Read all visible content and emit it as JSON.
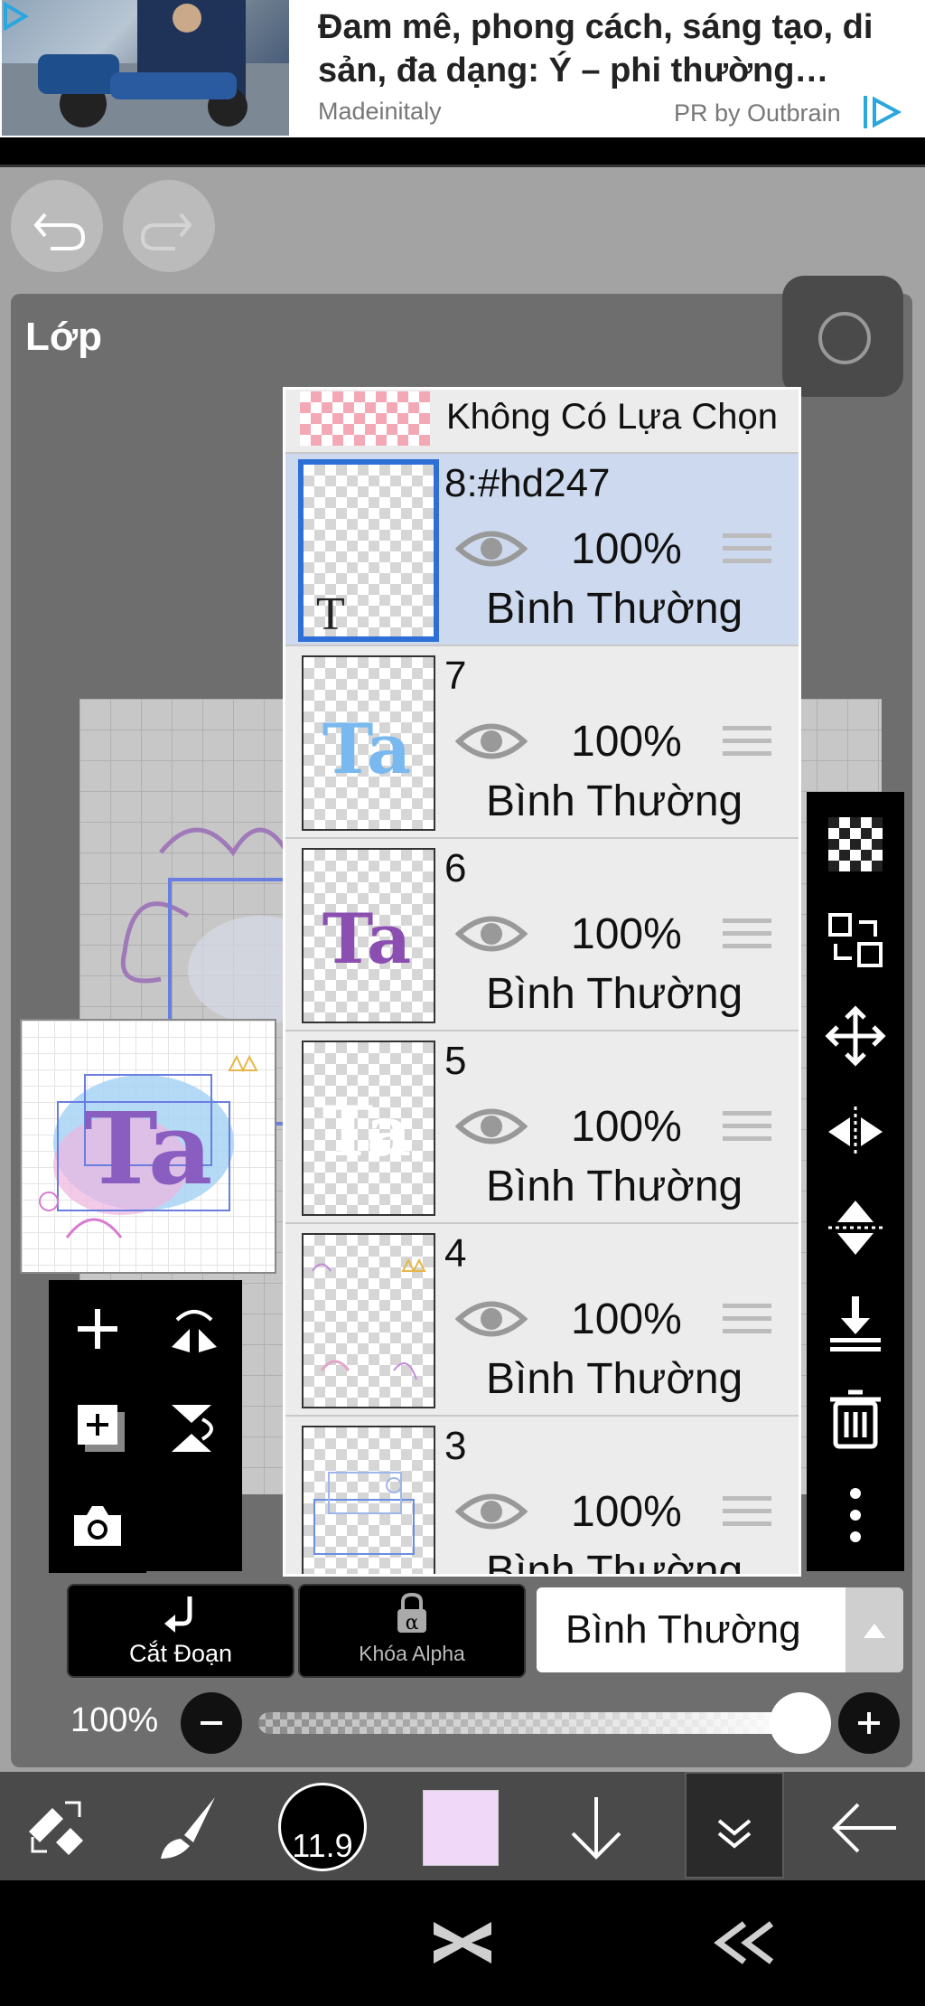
{
  "ad": {
    "title": "Đam mê, phong cách, sáng tạo, di sản, đa dạng: Ý – phi thường…",
    "source": "Madeinitaly",
    "sponsor": "PR by Outbrain"
  },
  "header": {
    "undo_icon": "undo-icon",
    "redo_icon": "redo-icon"
  },
  "layer_panel": {
    "title": "Lớp",
    "selection_row": "Không Có Lựa Chọn",
    "layers": [
      {
        "name": "8:#hd247",
        "opacity": "100%",
        "mode": "Bình Thường",
        "selected": true
      },
      {
        "name": "7",
        "opacity": "100%",
        "mode": "Bình Thường",
        "selected": false
      },
      {
        "name": "6",
        "opacity": "100%",
        "mode": "Bình Thường",
        "selected": false
      },
      {
        "name": "5",
        "opacity": "100%",
        "mode": "Bình Thường",
        "selected": false
      },
      {
        "name": "4",
        "opacity": "100%",
        "mode": "Bình Thường",
        "selected": false
      },
      {
        "name": "3",
        "opacity": "100%",
        "mode": "Bình Thường",
        "selected": false
      }
    ]
  },
  "bottom_controls": {
    "clip_label": "Cắt Đoạn",
    "alpha_lock_label": "Khóa Alpha",
    "blend_mode": "Bình Thường",
    "opacity_label": "100%",
    "opacity_value": 1.0
  },
  "toolbar": {
    "brush_size": "11.9",
    "color": "#efd8f8"
  },
  "colors": {
    "selected_layer_bg": "#cdd9ee",
    "selection_border": "#2d6fd6",
    "panel_bg": "#6e6e6e"
  }
}
